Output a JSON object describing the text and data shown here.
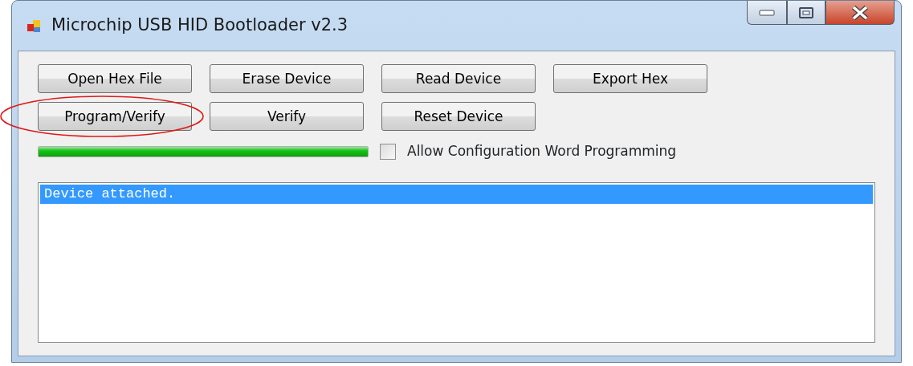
{
  "window": {
    "title": "Microchip USB HID Bootloader v2.3"
  },
  "button_rows": [
    [
      {
        "label": "Open Hex File",
        "highlighted": false
      },
      {
        "label": "Erase Device",
        "highlighted": false
      },
      {
        "label": "Read Device",
        "highlighted": false
      },
      {
        "label": "Export Hex",
        "highlighted": false
      }
    ],
    [
      {
        "label": "Program/Verify",
        "highlighted": true
      },
      {
        "label": "Verify",
        "highlighted": false
      },
      {
        "label": "Reset Device",
        "highlighted": false
      }
    ]
  ],
  "progress": {
    "level": 1
  },
  "config_checkbox": {
    "label": "Allow Configuration Word Programming",
    "checked": false
  },
  "log": [
    {
      "text": "Device attached.",
      "selected": true
    }
  ]
}
